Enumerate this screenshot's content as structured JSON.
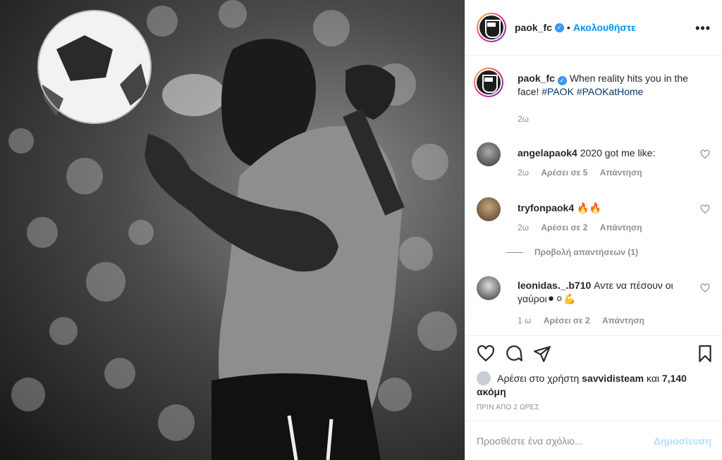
{
  "header": {
    "username": "paok_fc",
    "verified_badge": "✓",
    "dot": "•",
    "follow": "Ακολουθήστε",
    "more": "•••"
  },
  "caption": {
    "username": "paok_fc",
    "text": "When reality hits you in the face!",
    "hashtags": "#PAOK #PAOKatHome",
    "time": "2ω"
  },
  "comments": [
    {
      "username": "angelapaok4",
      "text": "2020 got me like:",
      "time": "2ω",
      "likes": "Αρέσει σε 5",
      "reply": "Απάντηση"
    },
    {
      "username": "tryfonpaok4",
      "text": "🔥🔥",
      "time": "2ω",
      "likes": "Αρέσει σε 2",
      "reply": "Απάντηση"
    },
    {
      "username": "leonidas._.b710",
      "text": "Αντε να πέσουν οι γαύροι⚫⚪💪",
      "time": "1 ω",
      "likes": "Αρέσει σε 2",
      "reply": "Απάντηση"
    }
  ],
  "view_replies": "Προβολή απαντήσεων (1)",
  "likes": {
    "prefix": "Αρέσει στο χρήστη",
    "user": "savvidisteam",
    "and": "και",
    "count": "7,140 ακόμη"
  },
  "timestamp": "ΠΡΙΝ ΑΠΟ 2 ΩΡΕΣ",
  "add_comment": {
    "placeholder": "Προσθέστε ένα σχόλιο...",
    "post": "Δημοσίευση"
  },
  "colors": {
    "accent": "#0095f6",
    "verified": "#3897f0"
  }
}
